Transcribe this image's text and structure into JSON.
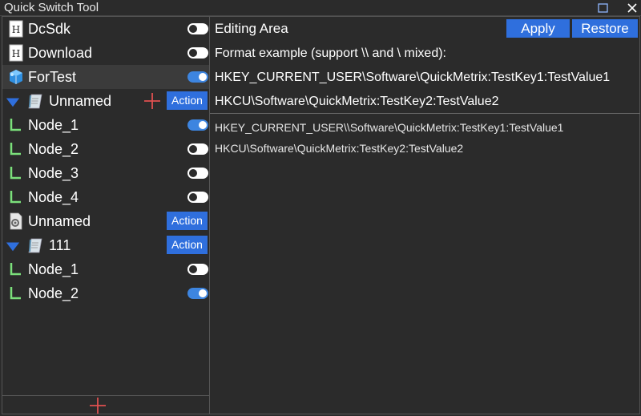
{
  "window": {
    "title": "Quick Switch Tool"
  },
  "tree": [
    {
      "label": "DcSdk",
      "icon": "file-h-icon",
      "toggle": "off"
    },
    {
      "label": "Download",
      "icon": "file-h-icon",
      "toggle": "off"
    },
    {
      "label": "ForTest",
      "icon": "cube-icon",
      "toggle": "on",
      "selected": true
    },
    {
      "label": "Unnamed",
      "icon": "notebook-icon",
      "expander": true,
      "action": "Action",
      "plus": true
    },
    {
      "label": "Node_1",
      "icon": "node-icon",
      "toggle": "on"
    },
    {
      "label": "Node_2",
      "icon": "node-icon",
      "toggle": "off"
    },
    {
      "label": "Node_3",
      "icon": "node-icon",
      "toggle": "off"
    },
    {
      "label": "Node_4",
      "icon": "node-icon",
      "toggle": "off"
    },
    {
      "label": "Unnamed",
      "icon": "gear-file-icon",
      "action": "Action"
    },
    {
      "label": "111",
      "icon": "notebook-icon",
      "expander": true,
      "action": "Action"
    },
    {
      "label": "Node_1",
      "icon": "node-icon",
      "toggle": "off"
    },
    {
      "label": "Node_2",
      "icon": "node-icon",
      "toggle": "on"
    }
  ],
  "editor": {
    "title": "Editing Area",
    "apply_label": "Apply",
    "restore_label": "Restore",
    "format_hint": "Format example (support \\\\ and \\ mixed):",
    "example_1": "HKEY_CURRENT_USER\\Software\\QuickMetrix:TestKey1:TestValue1",
    "example_2": "HKCU\\Software\\QuickMetrix:TestKey2:TestValue2",
    "lines": [
      "HKEY_CURRENT_USER\\\\Software\\QuickMetrix:TestKey1:TestValue1",
      "HKCU\\Software\\QuickMetrix:TestKey2:TestValue2"
    ]
  },
  "colors": {
    "background": "#2b2b2b",
    "accent": "#2f6fdd",
    "toggle_on": "#3d85e0",
    "plus": "#e05050",
    "node_icon": "#7be07b"
  }
}
